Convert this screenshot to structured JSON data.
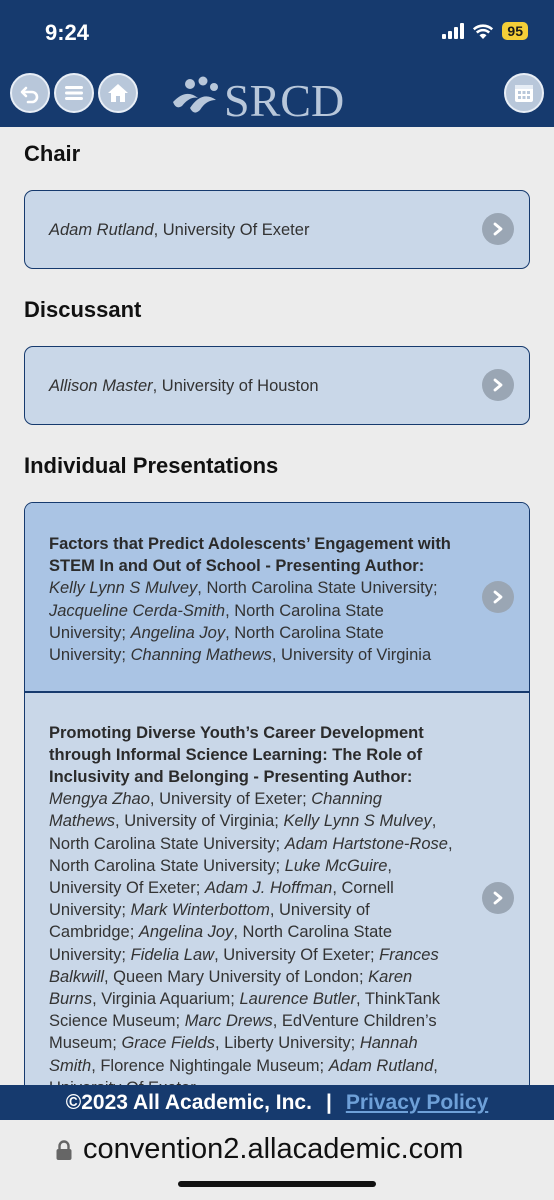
{
  "status": {
    "time": "9:24",
    "battery": "95"
  },
  "header": {
    "logo_text": "SRCD"
  },
  "sections": {
    "chair": "Chair",
    "discussant": "Discussant",
    "presentations": "Individual Presentations"
  },
  "chair": {
    "name": "Adam Rutland",
    "affiliation": ", University Of Exeter"
  },
  "discussant": {
    "name": "Allison Master",
    "affiliation": ", University of Houston"
  },
  "presentation1": {
    "title": "Factors that Predict Adolescents’ Engagement with STEM In and Out of School - Presenting Author:",
    "authors": [
      {
        "name": "Kelly Lynn S Mulvey",
        "aff": ", North Carolina State University; "
      },
      {
        "name": "Jacqueline Cerda-Smith",
        "aff": ", North Carolina State University; "
      },
      {
        "name": "Angelina Joy",
        "aff": ", North Carolina State University; "
      },
      {
        "name": "Channing Mathews",
        "aff": ", University of Virginia"
      }
    ]
  },
  "presentation2": {
    "title": "Promoting Diverse Youth’s Career Development through Informal Science Learning: The Role of Inclusivity and Belonging - Presenting Author:",
    "authors": [
      {
        "name": "Mengya Zhao",
        "aff": ", University of Exeter; "
      },
      {
        "name": "Channing Mathews",
        "aff": ", University of Virginia; "
      },
      {
        "name": "Kelly Lynn S Mulvey",
        "aff": ", North Carolina State University; "
      },
      {
        "name": "Adam Hartstone-Rose",
        "aff": ", North Carolina State University; "
      },
      {
        "name": "Luke McGuire",
        "aff": ", University Of Exeter; "
      },
      {
        "name": "Adam J. Hoffman",
        "aff": ", Cornell University; "
      },
      {
        "name": "Mark Winterbottom",
        "aff": ", University of Cambridge; "
      },
      {
        "name": "Angelina Joy",
        "aff": ", North Carolina State University; "
      },
      {
        "name": "Fidelia Law",
        "aff": ", University Of Exeter; "
      },
      {
        "name": "Frances Balkwill",
        "aff": ", Queen Mary University of London; "
      },
      {
        "name": "Karen Burns",
        "aff": ", Virginia Aquarium; "
      },
      {
        "name": "Laurence Butler",
        "aff": ", ThinkTank Science Museum; "
      },
      {
        "name": "Marc Drews",
        "aff": ", EdVenture Children’s Museum; "
      },
      {
        "name": "Grace Fields",
        "aff": ", Liberty University; "
      },
      {
        "name": "Hannah Smith",
        "aff": ", Florence Nightingale Museum; "
      },
      {
        "name": "Adam Rutland",
        "aff": ", University Of Exeter"
      }
    ]
  },
  "footer": {
    "copyright": "©2023 All Academic, Inc.",
    "separator": "|",
    "privacy": "Privacy Policy"
  },
  "browser": {
    "url": "convention2.allacademic.com"
  },
  "colors": {
    "navy": "#163a6e",
    "card": "#c9d7e8",
    "card_highlight": "#aac4e4",
    "battery": "#f4cf38"
  },
  "icons": [
    "back-icon",
    "menu-icon",
    "home-icon",
    "calendar-icon",
    "chevron-right-icon",
    "lock-icon"
  ]
}
